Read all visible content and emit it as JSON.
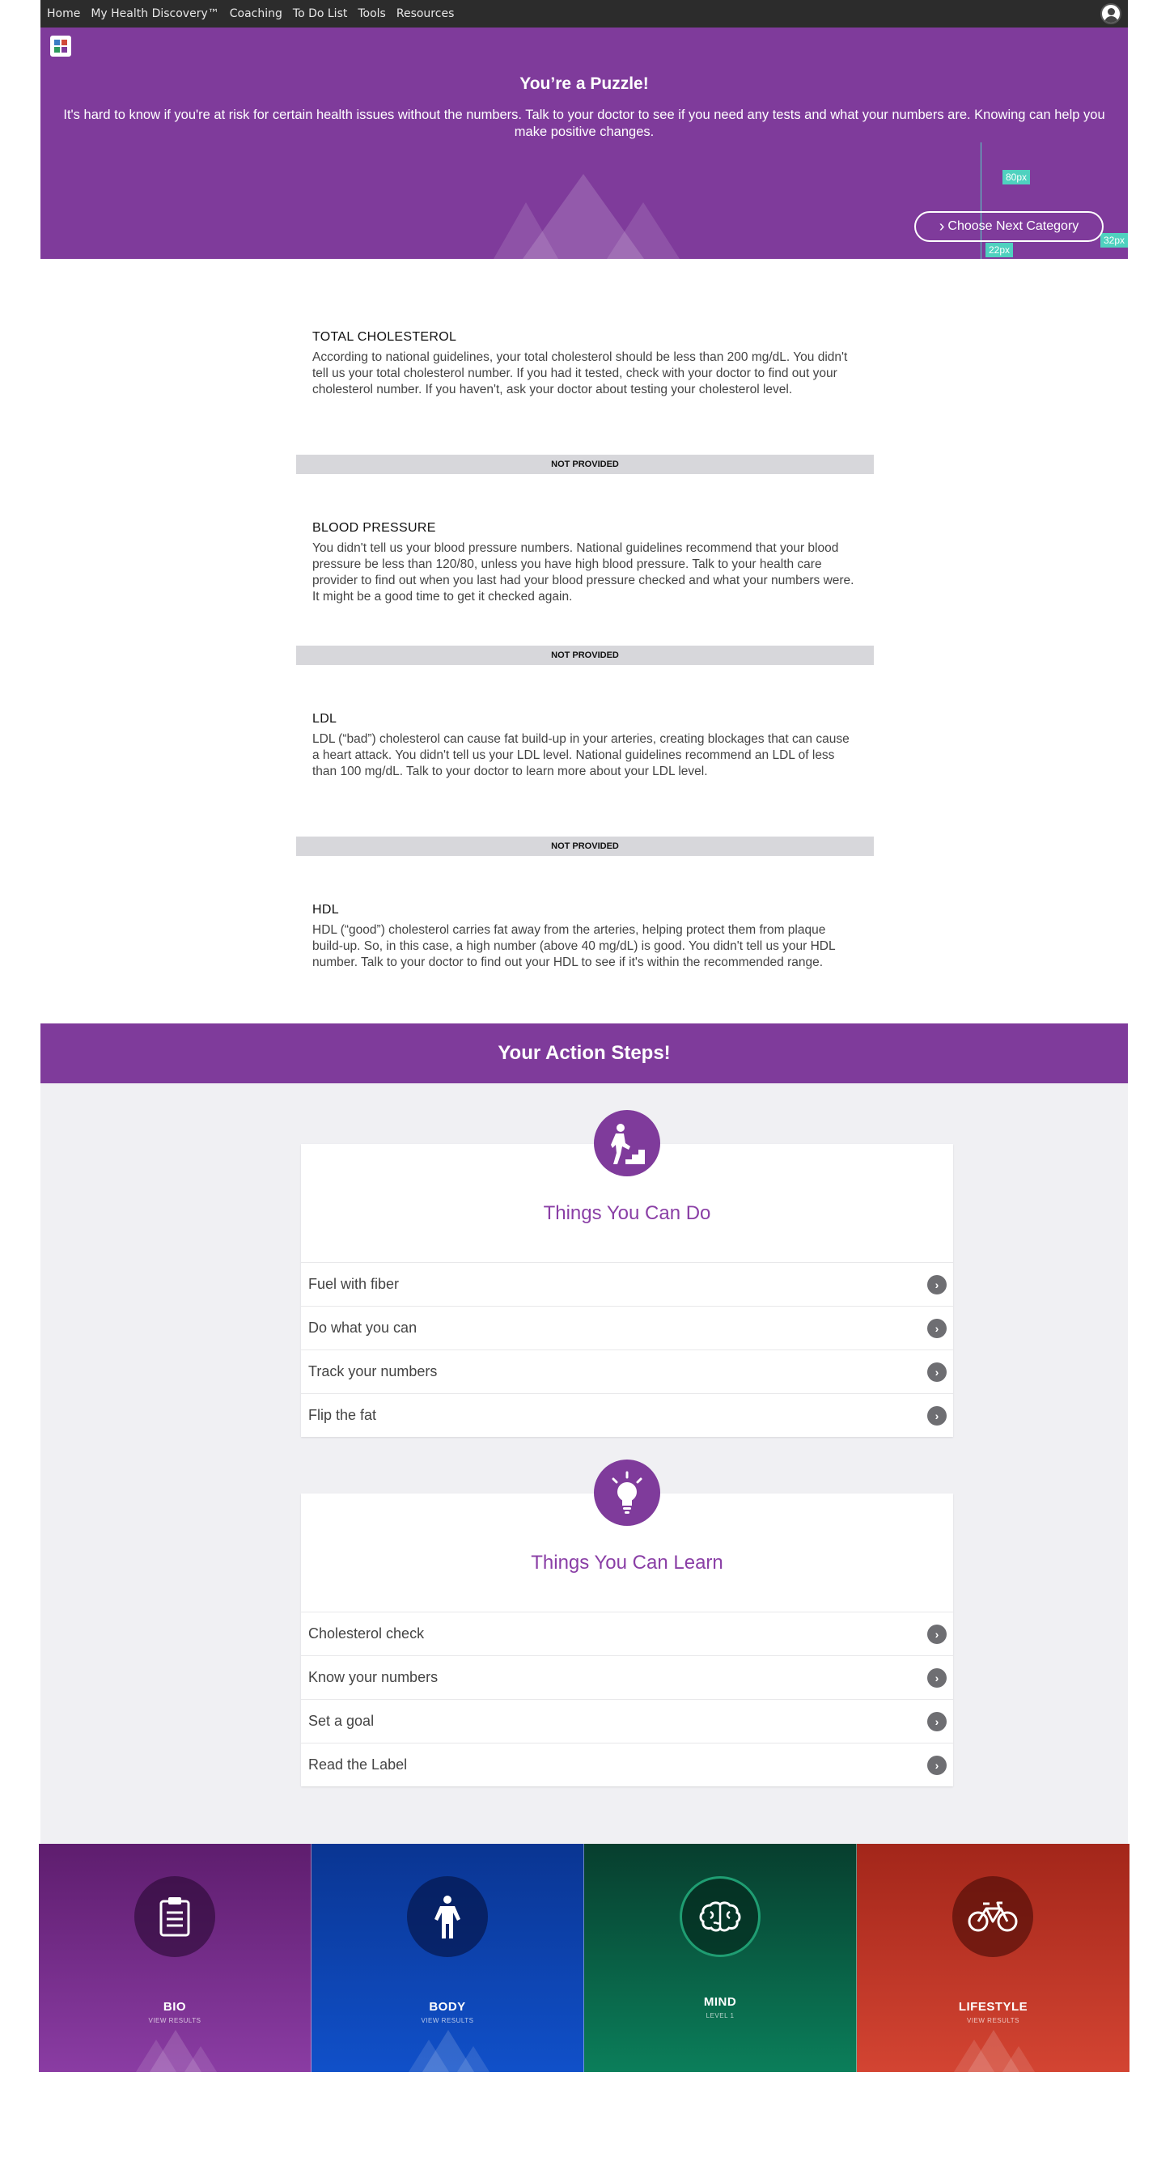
{
  "nav": {
    "items": [
      "Home",
      "My Health Discovery™",
      "Coaching",
      "To Do List",
      "Tools",
      "Resources"
    ],
    "user_icon": "user-avatar-icon"
  },
  "hero": {
    "title": "You’re a Puzzle!",
    "description": "It's hard to know if you're at risk for certain health issues without the numbers. Talk to your doctor to see if you need any tests and what your numbers are. Knowing can help you make positive changes.",
    "next_button": "Choose Next Category",
    "measure_labels": [
      "80px",
      "22px",
      "32px"
    ],
    "color": "#7f3b9b"
  },
  "metrics": [
    {
      "title": "TOTAL CHOLESTEROL",
      "text": "According to national guidelines, your total cholesterol should be less than 200 mg/dL. You didn't tell us your total cholesterol number. If you had it tested, check with your doctor to find out your cholesterol number. If you haven't, ask your doctor about testing your cholesterol level.",
      "status": "NOT PROVIDED"
    },
    {
      "title": "BLOOD PRESSURE",
      "text": "You didn't tell us your blood pressure numbers. National guidelines recommend that your blood pressure be less than 120/80, unless you have high blood pressure. Talk to your health care provider to find out when you last had your blood pressure checked and what your numbers were. It might be a good time to get it checked again.",
      "status": "NOT PROVIDED"
    },
    {
      "title": "LDL",
      "text": "LDL (“bad”) cholesterol can cause fat build-up in your arteries, creating blockages that can cause a heart attack. You didn't tell us your LDL level. National guidelines recommend an LDL of less than 100 mg/dL. Talk to your doctor to learn more about your LDL level.",
      "status": "NOT PROVIDED"
    },
    {
      "title": "HDL",
      "text": "HDL (“good”) cholesterol carries fat away from the arteries, helping protect them from plaque build-up. So, in this case, a high number (above 40 mg/dL) is good. You didn't tell us your HDL number. Talk to your doctor to find out your HDL to see if it's within the recommended range."
    }
  ],
  "action_steps": {
    "header": "Your Action Steps!",
    "do": {
      "title": "Things You Can Do",
      "icon": "climbing-stairs-icon",
      "items": [
        "Fuel with fiber",
        "Do what you can",
        "Track your numbers",
        "Flip the fat"
      ]
    },
    "learn": {
      "title": "Things You Can Learn",
      "icon": "lightbulb-icon",
      "items": [
        "Cholesterol check",
        "Know your numbers",
        "Set a goal",
        "Read the Label"
      ]
    }
  },
  "categories": [
    {
      "name": "BIO",
      "sub": "VIEW RESULTS",
      "icon": "clipboard-icon",
      "color_top": "#5e1d6e",
      "color_bottom": "#8a3ca3"
    },
    {
      "name": "BODY",
      "sub": "VIEW RESULTS",
      "icon": "person-icon",
      "color_top": "#0a3592",
      "color_bottom": "#1050c9"
    },
    {
      "name": "MIND",
      "sub": "LEVEL 1",
      "icon": "brain-icon",
      "color_top": "#073e2e",
      "color_bottom": "#0b7e5a"
    },
    {
      "name": "LIFESTYLE",
      "sub": "VIEW RESULTS",
      "icon": "bicycle-icon",
      "color_top": "#a3261a",
      "color_bottom": "#d34432"
    }
  ]
}
